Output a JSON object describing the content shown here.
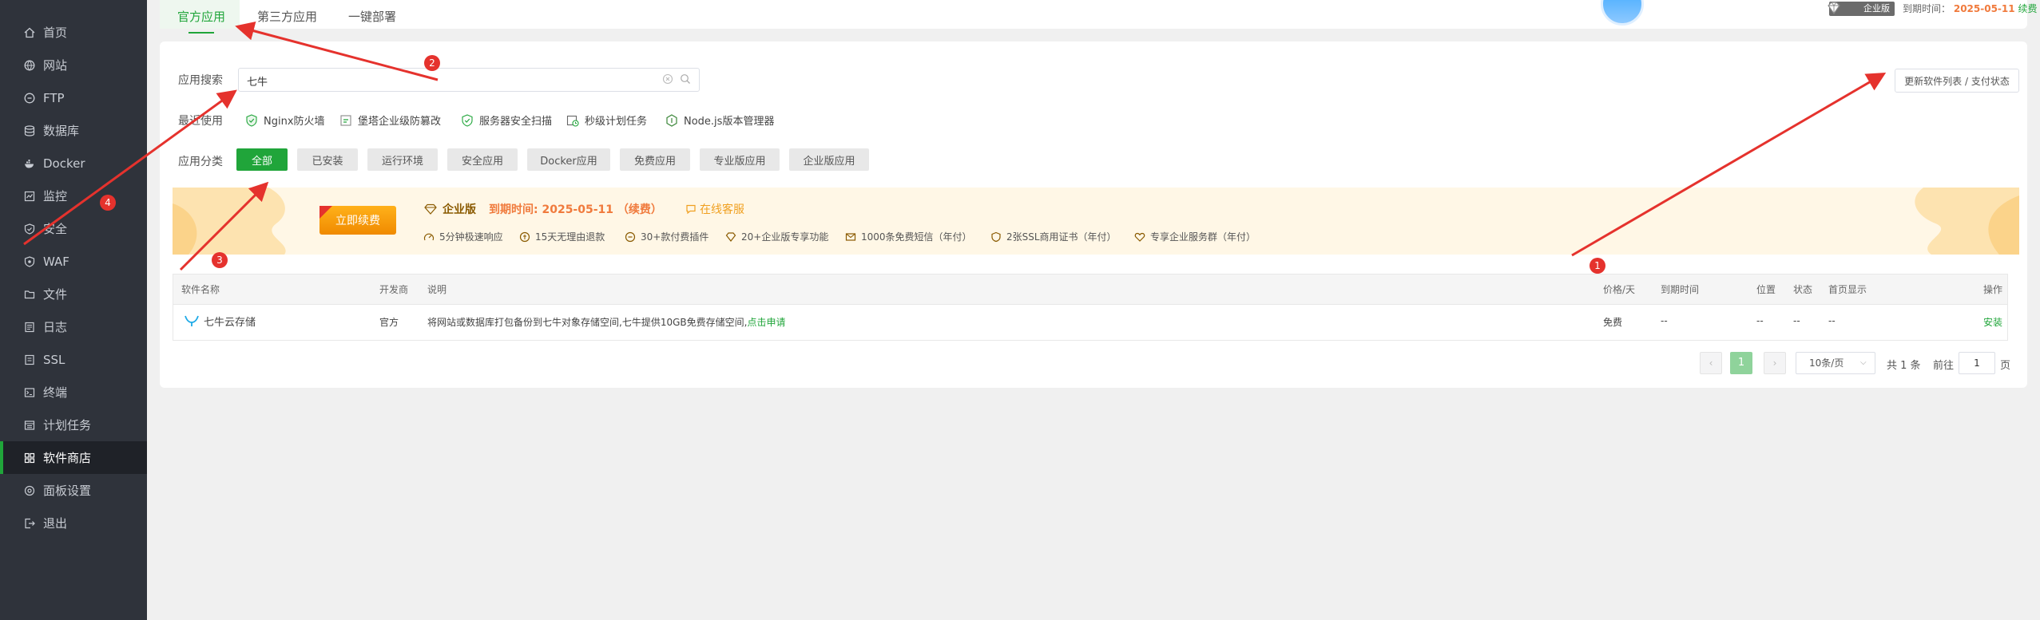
{
  "sidebar": {
    "items": [
      {
        "label": "首页",
        "icon": "home-icon"
      },
      {
        "label": "网站",
        "icon": "globe-icon"
      },
      {
        "label": "FTP",
        "icon": "ftp-icon"
      },
      {
        "label": "数据库",
        "icon": "database-icon"
      },
      {
        "label": "Docker",
        "icon": "docker-icon"
      },
      {
        "label": "监控",
        "icon": "monitor-icon"
      },
      {
        "label": "安全",
        "icon": "shield-icon"
      },
      {
        "label": "WAF",
        "icon": "waf-shield-icon"
      },
      {
        "label": "文件",
        "icon": "folder-icon"
      },
      {
        "label": "日志",
        "icon": "log-icon"
      },
      {
        "label": "SSL",
        "icon": "ssl-icon"
      },
      {
        "label": "终端",
        "icon": "terminal-icon"
      },
      {
        "label": "计划任务",
        "icon": "task-icon"
      },
      {
        "label": "软件商店",
        "icon": "grid-icon",
        "active": true
      },
      {
        "label": "面板设置",
        "icon": "gear-icon"
      },
      {
        "label": "退出",
        "icon": "logout-icon"
      }
    ]
  },
  "tabs": [
    {
      "label": "官方应用",
      "active": true
    },
    {
      "label": "第三方应用"
    },
    {
      "label": "一键部署"
    }
  ],
  "header": {
    "edition_badge": "企业版",
    "expiry_label": "到期时间：",
    "expiry_date": "2025-05-11",
    "renew": "续费"
  },
  "search": {
    "label": "应用搜索",
    "value": "七牛"
  },
  "update_button": "更新软件列表 / 支付状态",
  "recent": {
    "label": "最近使用",
    "items": [
      {
        "label": "Nginx防火墙",
        "icon": "nginx-waf-icon"
      },
      {
        "label": "堡塔企业级防篡改",
        "icon": "tamper-proof-icon"
      },
      {
        "label": "服务器安全扫描",
        "icon": "security-scan-icon"
      },
      {
        "label": "秒级计划任务",
        "icon": "clock-icon"
      },
      {
        "label": "Node.js版本管理器",
        "icon": "nodejs-icon"
      }
    ]
  },
  "categories": {
    "label": "应用分类",
    "items": [
      {
        "label": "全部",
        "active": true
      },
      {
        "label": "已安装"
      },
      {
        "label": "运行环境"
      },
      {
        "label": "安全应用"
      },
      {
        "label": "Docker应用"
      },
      {
        "label": "免费应用"
      },
      {
        "label": "专业版应用"
      },
      {
        "label": "企业版应用"
      }
    ]
  },
  "banner": {
    "renew_button": "立即续费",
    "title": "企业版",
    "expiry": "到期时间: 2025-05-11 （续费）",
    "service": "在线客服",
    "features": [
      {
        "label": "5分钟极速响应",
        "icon": "speed-icon"
      },
      {
        "label": "15天无理由退款",
        "icon": "refund-icon"
      },
      {
        "label": "30+款付费插件",
        "icon": "plugin-icon"
      },
      {
        "label": "20+企业版专享功能",
        "icon": "diamond-icon"
      },
      {
        "label": "1000条免费短信（年付）",
        "icon": "sms-icon"
      },
      {
        "label": "2张SSL商用证书（年付）",
        "icon": "cert-icon"
      },
      {
        "label": "专享企业服务群（年付）",
        "icon": "heart-icon"
      }
    ]
  },
  "table": {
    "headers": [
      "软件名称",
      "开发商",
      "说明",
      "价格/天",
      "到期时间",
      "位置",
      "状态",
      "首页显示",
      "操作"
    ],
    "rows": [
      {
        "name": "七牛云存储",
        "vendor": "官方",
        "desc": "将网站或数据库打包备份到七牛对象存储空间,七牛提供10GB免费存储空间,",
        "desc_link": "点击申请",
        "price": "免费",
        "expiry": "--",
        "location": "--",
        "status": "--",
        "home": "--",
        "action": "安装"
      }
    ]
  },
  "pagination": {
    "prev": "‹",
    "page": "1",
    "next": "›",
    "page_size": "10条/页",
    "total": "共 1 条",
    "goto_label": "前往",
    "goto_value": "1",
    "page_suffix": "页"
  },
  "annotations": [
    "1",
    "2",
    "3",
    "4"
  ],
  "colors": {
    "accent": "#20a53a",
    "sidebar_bg": "#2f333b",
    "banner_bg": "#fff7e6",
    "annotation_red": "#e5322d",
    "orange": "#f07a3c"
  }
}
